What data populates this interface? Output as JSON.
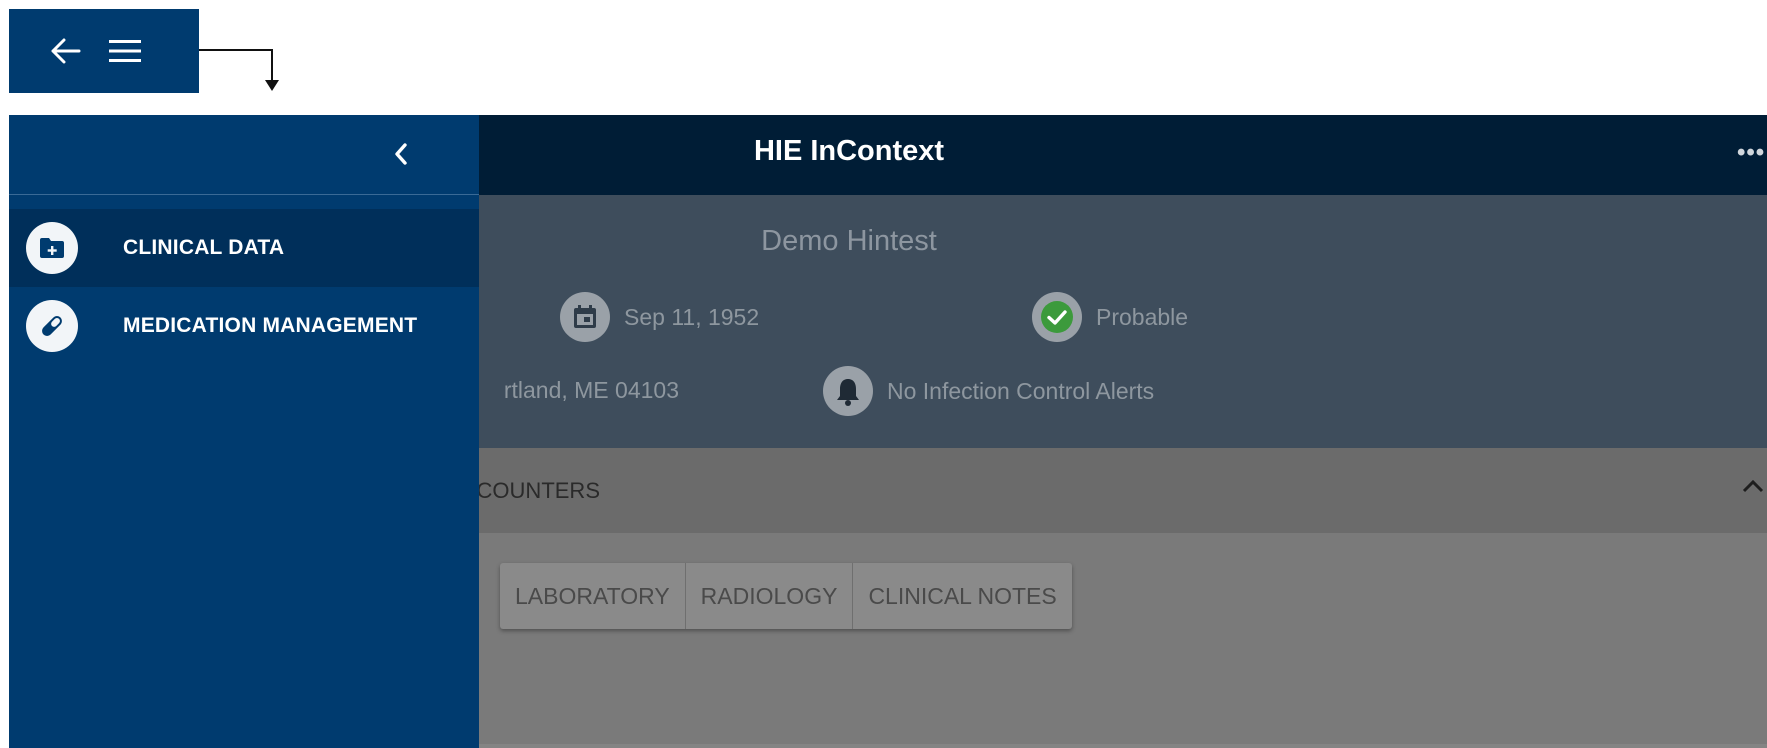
{
  "colors": {
    "nav_blue": "#003b6f",
    "topbar_dark": "#001d36",
    "patient_panel": "#3e4d5c",
    "success_green": "#3c9a3c"
  },
  "toolbar_snippet": {
    "back_icon": "arrow-left-icon",
    "menu_icon": "hamburger-menu-icon"
  },
  "header": {
    "title": "HIE InContext",
    "more_icon": "more-horizontal-icon",
    "more_glyph": "•••"
  },
  "patient": {
    "name": "Demo Hintest",
    "dob": "Sep 11, 1952",
    "match_status": "Probable",
    "address": "rtland, ME 04103",
    "infection_alerts": "No Infection Control Alerts"
  },
  "section": {
    "title": "COUNTERS",
    "expand_icon": "chevron-up-icon"
  },
  "tabs": [
    {
      "label": "LABORATORY"
    },
    {
      "label": "RADIOLOGY"
    },
    {
      "label": "CLINICAL NOTES"
    }
  ],
  "drawer": {
    "close_icon": "chevron-left-icon",
    "items": [
      {
        "label": "CLINICAL DATA",
        "icon": "folder-plus-icon",
        "active": true
      },
      {
        "label": "MEDICATION MANAGEMENT",
        "icon": "pill-icon",
        "active": false
      }
    ]
  }
}
